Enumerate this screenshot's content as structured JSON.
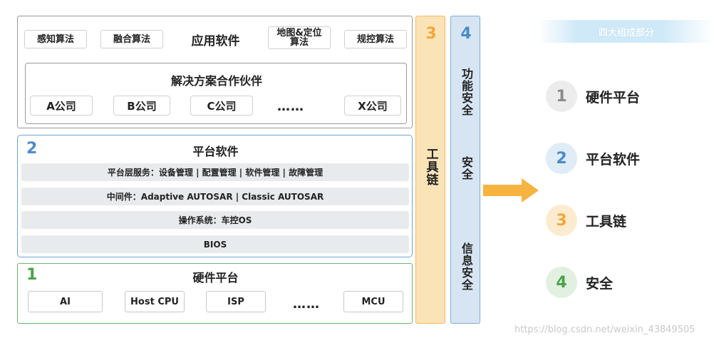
{
  "application": {
    "title": "应用软件",
    "modules": [
      "感知算法",
      "融合算法",
      "地图&定位算法",
      "规控算法"
    ],
    "partners": {
      "title": "解决方案合作伙伴",
      "companies": [
        "A公司",
        "B公司",
        "C公司",
        "X公司"
      ],
      "ellipsis": "……"
    }
  },
  "platform": {
    "number": "2",
    "title": "平台软件",
    "layers": [
      "平台层服务：设备管理 | 配置管理 | 软件管理 | 故障管理",
      "中间件：Adaptive AUTOSAR   | Classic AUTOSAR",
      "操作系统：车控OS",
      "BIOS"
    ]
  },
  "hardware": {
    "number": "1",
    "title": "硬件平台",
    "components": [
      "AI",
      "Host CPU",
      "ISP",
      "MCU"
    ],
    "ellipsis": "……"
  },
  "toolchain": {
    "number": "3",
    "label": "工具链"
  },
  "safety": {
    "number": "4",
    "functional": "功能安全",
    "security": "安全",
    "info": "信息安全"
  },
  "legend": {
    "title": "四大组成部分",
    "items": [
      {
        "number": "1",
        "label": "硬件平台",
        "color": "#8a8a8a",
        "bg": "#ececec"
      },
      {
        "number": "2",
        "label": "平台软件",
        "color": "#4a8cc6",
        "bg": "#e0ecf6"
      },
      {
        "number": "3",
        "label": "工具链",
        "color": "#f2a73a",
        "bg": "#fdebd0"
      },
      {
        "number": "4",
        "label": "安全",
        "color": "#4aa34a",
        "bg": "#e2f0e2"
      }
    ]
  },
  "colors": {
    "arrow": "#f5b440",
    "platform_border": "#6fa3cf",
    "hardware_border": "#6fb36f",
    "tool_bg": "#fbe3b8",
    "safety_bg": "#d7e5f3"
  },
  "watermark": "https://blog.csdn.net/weixin_43849505"
}
